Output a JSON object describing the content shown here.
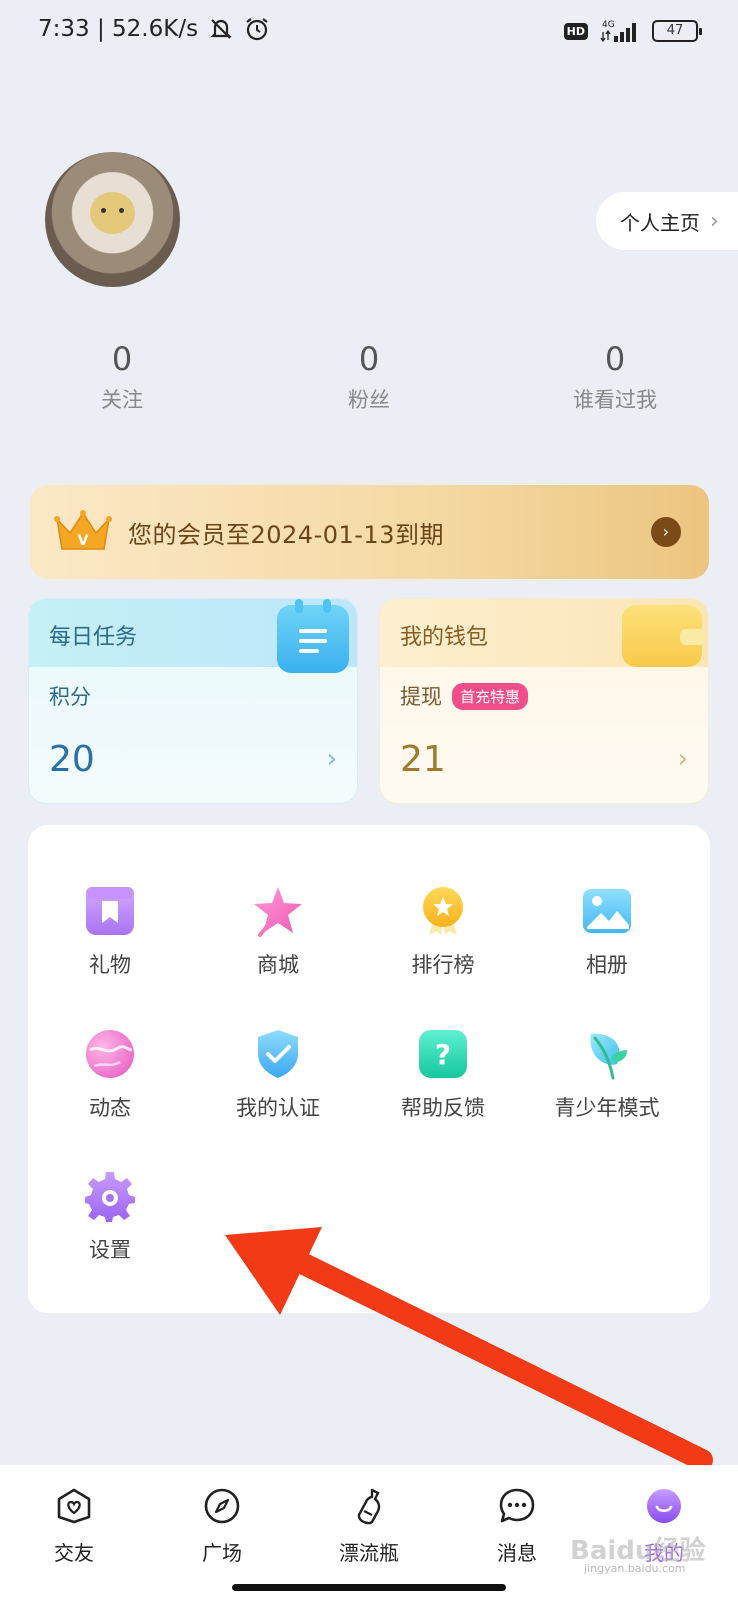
{
  "status_bar": {
    "time_speed": "7:33 | 52.6K/s",
    "network": "4G",
    "hd": "HD",
    "battery": "47"
  },
  "profile": {
    "homepage_label": "个人主页"
  },
  "stats": [
    {
      "value": "0",
      "label": "关注"
    },
    {
      "value": "0",
      "label": "粉丝"
    },
    {
      "value": "0",
      "label": "谁看过我"
    }
  ],
  "vip": {
    "text": "您的会员至2024-01-13到期",
    "crown_letter": "V"
  },
  "task_card": {
    "title": "每日任务",
    "sub": "积分",
    "value": "20"
  },
  "wallet_card": {
    "title": "我的钱包",
    "sub": "提现",
    "badge": "首充特惠",
    "value": "21"
  },
  "grid": [
    {
      "label": "礼物",
      "icon": "gift-icon"
    },
    {
      "label": "商城",
      "icon": "star-icon"
    },
    {
      "label": "排行榜",
      "icon": "medal-icon"
    },
    {
      "label": "相册",
      "icon": "photo-icon"
    },
    {
      "label": "动态",
      "icon": "planet-icon"
    },
    {
      "label": "我的认证",
      "icon": "shield-check-icon"
    },
    {
      "label": "帮助反馈",
      "icon": "help-icon"
    },
    {
      "label": "青少年模式",
      "icon": "leaf-icon"
    },
    {
      "label": "设置",
      "icon": "gear-icon"
    }
  ],
  "nav": [
    {
      "label": "交友",
      "icon": "heart-chat-icon"
    },
    {
      "label": "广场",
      "icon": "compass-icon"
    },
    {
      "label": "漂流瓶",
      "icon": "bottle-icon"
    },
    {
      "label": "消息",
      "icon": "message-icon"
    },
    {
      "label": "我的",
      "icon": "profile-face-icon",
      "active": true
    }
  ],
  "watermark": {
    "main": "Baidu经验",
    "sub": "jingyan.baidu.com"
  },
  "colors": {
    "accent": "#9b5cf0",
    "background": "#eceef6",
    "arrow": "#f23a16"
  }
}
